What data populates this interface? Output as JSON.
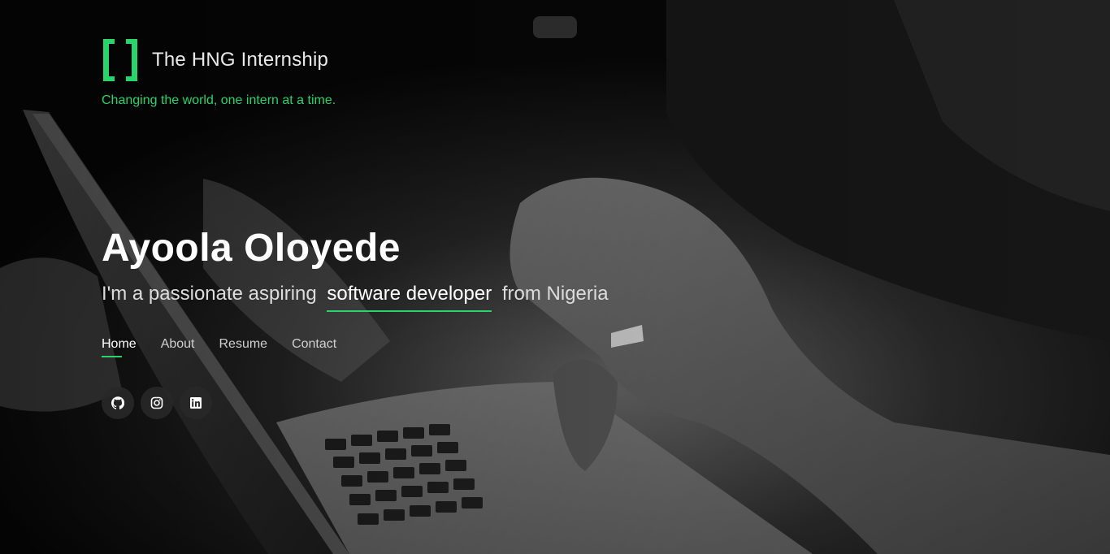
{
  "brand": {
    "name": "The HNG Internship",
    "tagline": "Changing the world, one intern at a time.",
    "accent_color": "#2bd36b"
  },
  "hero": {
    "name": "Ayoola Oloyede",
    "subtitle_before": "I'm a passionate aspiring",
    "subtitle_highlight": "software developer",
    "subtitle_after": "from Nigeria"
  },
  "nav": {
    "items": [
      {
        "label": "Home",
        "active": true
      },
      {
        "label": "About",
        "active": false
      },
      {
        "label": "Resume",
        "active": false
      },
      {
        "label": "Contact",
        "active": false
      }
    ]
  },
  "socials": [
    {
      "icon": "github-icon"
    },
    {
      "icon": "instagram-icon"
    },
    {
      "icon": "linkedin-icon"
    }
  ]
}
